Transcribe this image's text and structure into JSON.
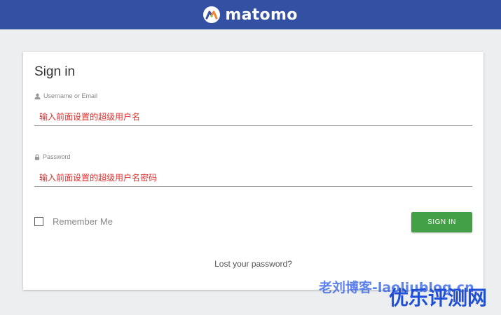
{
  "header": {
    "logo_text": "matomo",
    "brand_color": "#3450a3",
    "logo_icon": "matomo-logo-icon"
  },
  "form": {
    "title": "Sign in",
    "username": {
      "label": "Username or Email",
      "icon": "user-icon",
      "placeholder": "输入前面设置的超级用户名"
    },
    "password": {
      "label": "Password",
      "icon": "lock-icon",
      "placeholder": "输入前面设置的超级用户名密码"
    },
    "remember_label": "Remember Me",
    "remember_checked": false,
    "submit_label": "SIGN IN",
    "submit_color": "#43a047",
    "lost_password_label": "Lost your password?"
  },
  "watermark": {
    "line1": "老刘博客-laoliublog.cn",
    "line2": "优乐评测网"
  }
}
